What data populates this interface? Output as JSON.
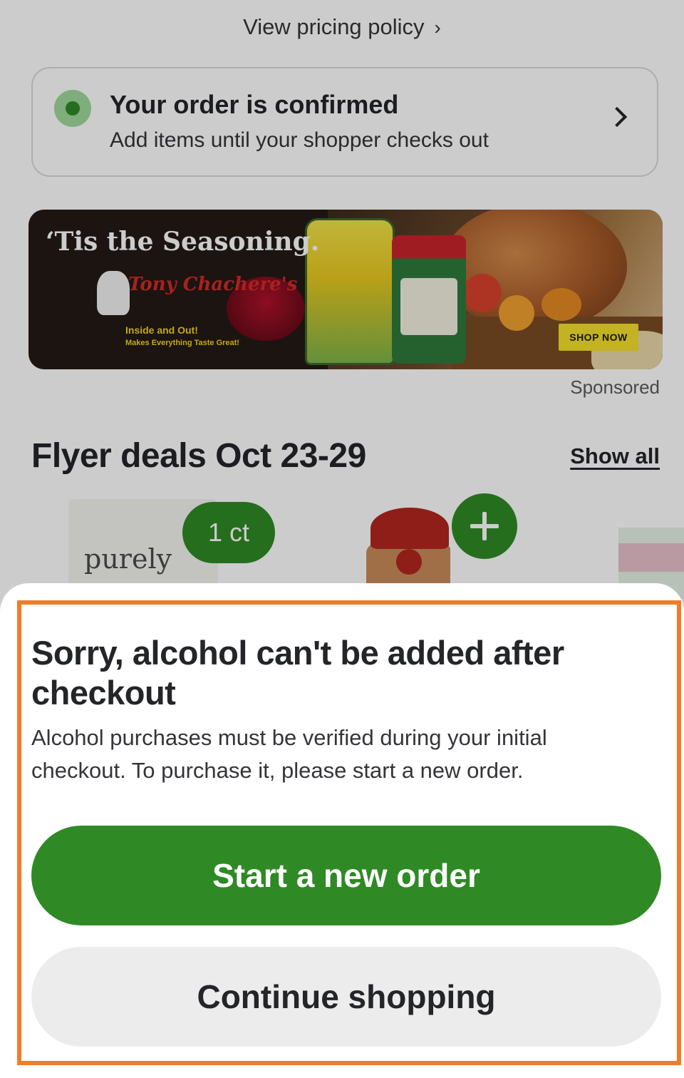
{
  "pricing_link": {
    "label": "View pricing policy",
    "chevron": "›"
  },
  "order_status": {
    "title": "Your order is confirmed",
    "subtitle": "Add items until your shopper checks out",
    "status_color": "#2f8a25"
  },
  "banner": {
    "headline": "‘Tis the Seasoning.",
    "brand": "Tony Chachere's",
    "tagline_1": "Inside and Out!",
    "tagline_2": "Makes Everything Taste Great!",
    "cta": "SHOP NOW",
    "sponsored_label": "Sponsored"
  },
  "flyer": {
    "title": "Flyer deals Oct 23-29",
    "show_all": "Show all",
    "products": [
      {
        "brand": "purely",
        "quantity": "1 ct"
      },
      {
        "add_icon": "plus-icon"
      },
      {}
    ]
  },
  "sheet": {
    "title": "Sorry, alcohol can't be added after checkout",
    "body": "Alcohol purchases must be verified during your initial checkout. To purchase it, please start a new order.",
    "primary_button": "Start a new order",
    "secondary_button": "Continue shopping"
  },
  "colors": {
    "brand_green": "#2f8a25",
    "highlight_orange": "#f07c2a",
    "secondary_button_bg": "#ececec"
  }
}
